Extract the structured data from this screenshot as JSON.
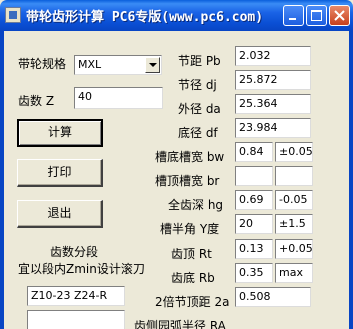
{
  "window": {
    "title": "带轮齿形计算 PC6专版(www.pc6.com)"
  },
  "left": {
    "belt_spec_label": "带轮规格",
    "belt_spec_value": "MXL",
    "teeth_label": "齿数 Z",
    "teeth_value": "40",
    "calc_button": "计算",
    "print_button": "打印",
    "exit_button": "退出",
    "segment_title": "齿数分段",
    "segment_desc": "宜以段内Zmin设计滚刀",
    "segment_value": "Z10-23  Z24-R",
    "extra_value": ""
  },
  "params": [
    {
      "label": "节距 Pb",
      "value": "2.032"
    },
    {
      "label": "节径 dj",
      "value": "25.872"
    },
    {
      "label": "外径 da",
      "value": "25.364"
    },
    {
      "label": "底径 df",
      "value": "23.984"
    },
    {
      "label": "槽底槽宽 bw",
      "value": "0.84",
      "tol": "±0.05"
    },
    {
      "label": "槽顶槽宽 br",
      "value": "",
      "tol": ""
    },
    {
      "label": "全齿深 hg",
      "value": "0.69",
      "tol": "-0.05"
    },
    {
      "label": "槽半角 Y度",
      "value": "20",
      "tol": "±1.5"
    },
    {
      "label": "齿顶 Rt",
      "value": "0.13",
      "tol": "+0.05"
    },
    {
      "label": "齿底 Rb",
      "value": "0.35",
      "tol": "max"
    },
    {
      "label": "2倍节顶距 2a",
      "value": "0.508"
    },
    {
      "label": "齿侧园弧半径 RA"
    }
  ]
}
